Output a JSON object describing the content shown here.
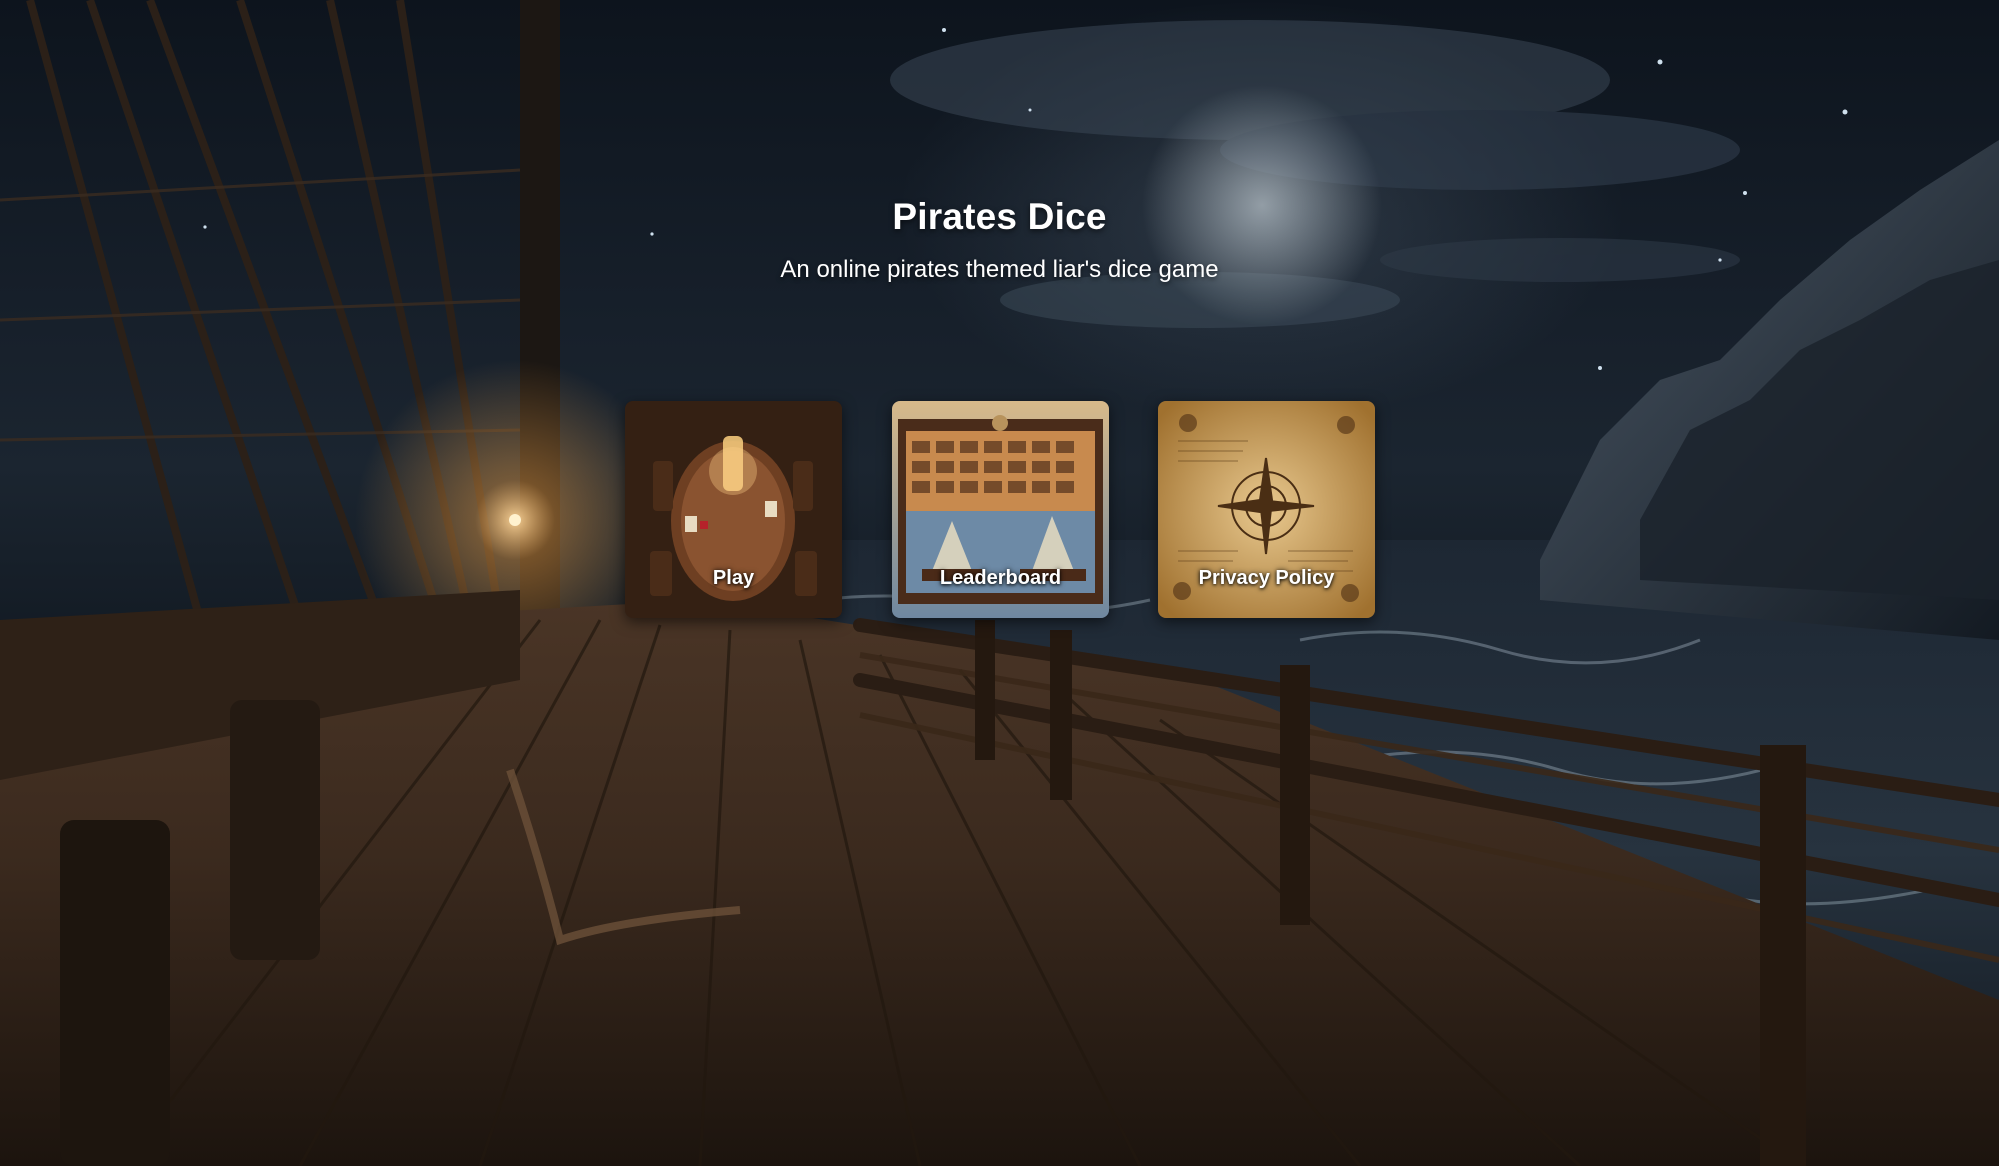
{
  "header": {
    "title": "Pirates Dice",
    "subtitle": "An online pirates themed liar's dice game"
  },
  "menu": {
    "items": [
      {
        "label": "Play",
        "icon": "tavern-table-image"
      },
      {
        "label": "Leaderboard",
        "icon": "scoreboard-image"
      },
      {
        "label": "Privacy Policy",
        "icon": "parchment-compass-image"
      }
    ]
  },
  "colors": {
    "title_text": "#ffffff",
    "background_sky": "#17202b",
    "deck_wood": "#3a2a1d"
  }
}
